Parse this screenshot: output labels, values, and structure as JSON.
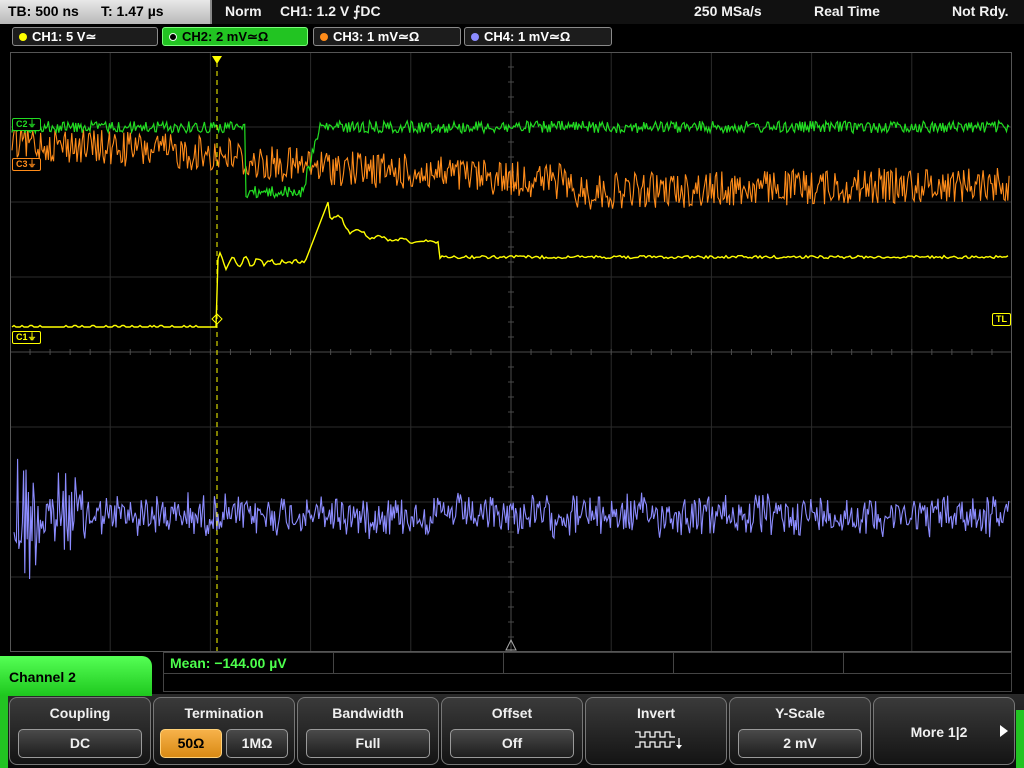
{
  "topbar": {
    "timebase": "TB: 500 ns",
    "trigger_time": "T: 1.47 µs",
    "trigger_mode": "Norm",
    "trigger_source": "CH1: 1.2 V ⨍DC",
    "sample_rate": "250 MSa/s",
    "acq_mode": "Real Time",
    "status": "Not Rdy."
  },
  "channels": [
    {
      "label": "CH1: 5 V≃",
      "color": "#ffff00"
    },
    {
      "label": "CH2: 2 mV≃Ω",
      "color": "#22dd22"
    },
    {
      "label": "CH3: 1 mV≃Ω",
      "color": "#ff8c1a"
    },
    {
      "label": "CH4: 1 mV≃Ω",
      "color": "#8c8cff"
    }
  ],
  "markers": {
    "c1": "C1⏚",
    "c2": "C2⏚",
    "c3": "C3⏚",
    "trigger_level": "TL",
    "trigger_pos": "T"
  },
  "measurement": {
    "mean": "Mean: −144.00 µV"
  },
  "menu": {
    "title": "Channel 2",
    "coupling": {
      "label": "Coupling",
      "value": "DC"
    },
    "termination": {
      "label": "Termination",
      "opt1": "50Ω",
      "opt2": "1MΩ"
    },
    "bandwidth": {
      "label": "Bandwidth",
      "value": "Full"
    },
    "offset": {
      "label": "Offset",
      "value": "Off"
    },
    "invert": {
      "label": "Invert",
      "icon": "inverted-pulse-icon"
    },
    "yscale": {
      "label": "Y-Scale",
      "value": "2 mV"
    },
    "more": {
      "label": "More 1|2"
    }
  },
  "colors": {
    "ch1": "#ffff00",
    "ch2": "#22dd22",
    "ch3": "#ff8c1a",
    "ch4": "#8c8cff",
    "menu_accent": "#22c422",
    "selected_option": "#f0a030"
  }
}
